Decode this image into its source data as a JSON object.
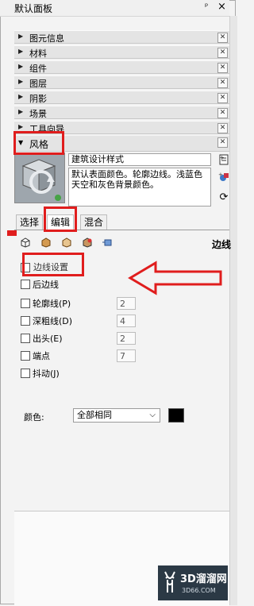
{
  "panel": {
    "title": "默认面板",
    "pin_glyph": "ᵖ",
    "close_glyph": "×"
  },
  "trays": [
    {
      "label": "图元信息"
    },
    {
      "label": "材料"
    },
    {
      "label": "组件"
    },
    {
      "label": "图层"
    },
    {
      "label": "阴影"
    },
    {
      "label": "场景"
    },
    {
      "label": "工具向导"
    }
  ],
  "style_tray": {
    "label": "风格",
    "style_name": "建筑设计样式",
    "description": "默认表面颜色。轮廓边线。浅蓝色天空和灰色背景颜色。"
  },
  "tabs": [
    {
      "label": "选择",
      "active": false
    },
    {
      "label": "编辑",
      "active": true
    },
    {
      "label": "混合",
      "active": false
    }
  ],
  "edit": {
    "section_title": "边线",
    "edge_settings_label": "边线设置",
    "back_edges": "后边线",
    "options": [
      {
        "label": "轮廓线(P)",
        "value": "2"
      },
      {
        "label": "深粗线(D)",
        "value": "4"
      },
      {
        "label": "出头(E)",
        "value": "2"
      },
      {
        "label": "端点",
        "value": "7"
      },
      {
        "label": "抖动(J)",
        "value": ""
      }
    ],
    "color_label": "颜色:",
    "color_select": "全部相同",
    "color_swatch": "#000000"
  },
  "watermark": {
    "text": "3D溜溜网",
    "sub": "3D66.COM"
  },
  "annotation_color": "#e01d1d"
}
